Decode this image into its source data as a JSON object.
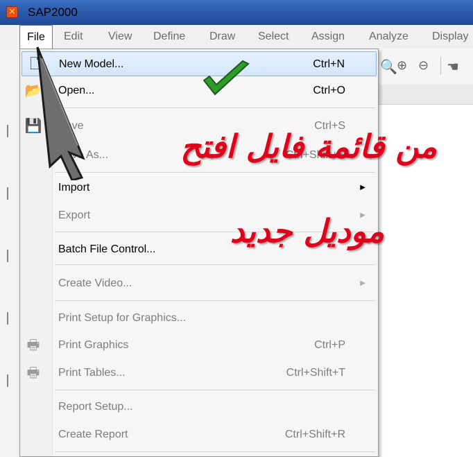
{
  "window": {
    "title": "SAP2000",
    "app_icon_glyph": "✕"
  },
  "menubar": {
    "items": [
      "File",
      "Edit",
      "View",
      "Define",
      "Draw",
      "Select",
      "Assign",
      "Analyze",
      "Display"
    ]
  },
  "file_menu": {
    "items": [
      {
        "label": "New Model...",
        "shortcut": "Ctrl+N"
      },
      {
        "label": "Open...",
        "shortcut": "Ctrl+O"
      },
      {
        "label": "Save",
        "shortcut": "Ctrl+S"
      },
      {
        "label": "Save As...",
        "shortcut": "Ctrl+Shift+S"
      },
      {
        "label": "Import",
        "submenu_arrow": "▶"
      },
      {
        "label": "Export",
        "submenu_arrow": "▶"
      },
      {
        "label": "Batch File Control..."
      },
      {
        "label": "Create Video...",
        "submenu_arrow": "▶"
      },
      {
        "label": "Print Setup for Graphics..."
      },
      {
        "label": "Print Graphics",
        "shortcut": "Ctrl+P"
      },
      {
        "label": "Print Tables...",
        "shortcut": "Ctrl+Shift+T"
      },
      {
        "label": "Report Setup..."
      },
      {
        "label": "Create Report",
        "shortcut": "Ctrl+Shift+R"
      }
    ]
  },
  "annotation": {
    "line1": "من قائمة فايل افتح",
    "line2": "موديل جديد",
    "color": "#e0001b",
    "checkmark_color": "#2e9c2a"
  },
  "colors": {
    "titlebar": "#2a58a8",
    "highlight": "#d4e7fa"
  }
}
